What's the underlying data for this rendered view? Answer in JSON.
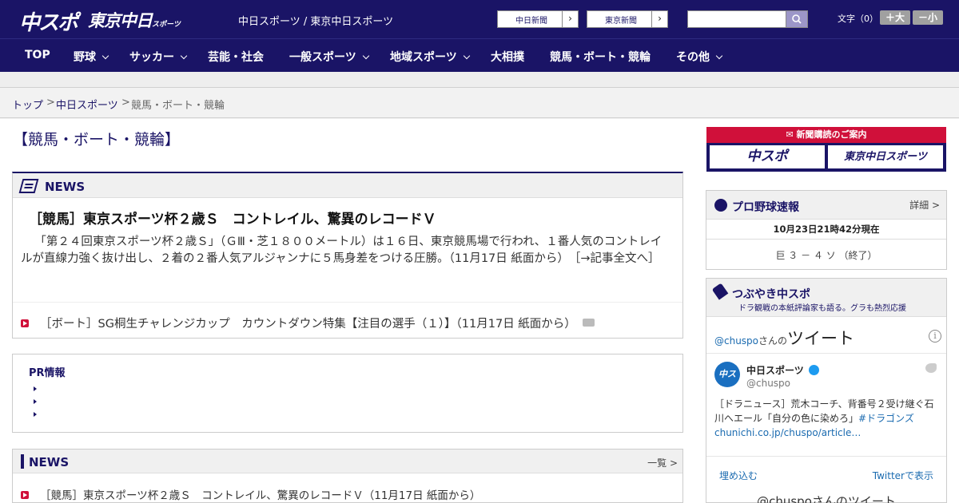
{
  "header": {
    "logo_chuspo": "中スポ",
    "logo_tokyo": "東京中日",
    "logo_tokyo_small": "スポーツ",
    "site_title": "中日スポーツ / 東京中日スポーツ",
    "btn_chunichi": "中日新聞",
    "btn_tokyo": "東京新聞",
    "btn_arrow": "›",
    "search_value": "",
    "fontsize_label": "文字（0）",
    "font_larger": "＋大",
    "font_smaller": "－小"
  },
  "nav": [
    {
      "label": "TOP"
    },
    {
      "label": "野球"
    },
    {
      "label": "サッカー"
    },
    {
      "label": "芸能・社会"
    },
    {
      "label": "一般スポーツ"
    },
    {
      "label": "地域スポーツ"
    },
    {
      "label": "大相撲"
    },
    {
      "label": "競馬・ボート・競輪"
    },
    {
      "label": "その他"
    }
  ],
  "breadcrumb": {
    "top": "トップ",
    "sep": ">",
    "section": "中日スポーツ",
    "current": "競馬・ボート・競輪"
  },
  "page_title": "【競馬・ボート・競輪】",
  "news": {
    "label": "NEWS",
    "headline": "［競馬］東京スポーツ杯２歳Ｓ　コントレイル、驚異のレコードＶ",
    "lead": "「第２４回東京スポーツ杯２歳Ｓ」（ＧⅢ・芝１８００メートル）は１６日、東京競馬場で行われ、１番人気のコントレイルが直線力強く抜け出し、２着の２番人気アルジャンナに５馬身差をつける圧勝。（11月17日 紙面から）　［→記事全文へ］",
    "sub_item": "［ボート］SG桐生チャレンジカップ　カウントダウン特集【注目の選手（１）】（11月17日 紙面から）"
  },
  "pr": {
    "title": "PR情報"
  },
  "news_list": {
    "label": "NEWS",
    "more": "一覧 >",
    "items": [
      "［競馬］東京スポーツ杯２歳Ｓ　コントレイル、驚異のレコードＶ（11月17日 紙面から）"
    ]
  },
  "sidebar": {
    "subscribe_title": "新聞購読のご案内",
    "subscribe_chuspo": "中スポ",
    "subscribe_tokyo": "東京中日スポーツ",
    "baseball_title": "プロ野球速報",
    "baseball_detail": "詳細 >",
    "baseball_time": "10月23日21時42分現在",
    "baseball_score": "巨 ３ － ４ ソ （終了）",
    "tweet_title": "つぶやき中スポ",
    "tweet_sub": "ドラ観戦の本紙評論家も語る。グラも熱烈応援",
    "tweet_handle": "@chuspo",
    "tweet_handle_suffix": "さんの",
    "tweet_word": "ツイート",
    "tweet_info": "i",
    "tweet_avatar": "中スポ",
    "tweet_name": "中日スポーツ",
    "tweet_screen": "@chuspo",
    "tweet_text": "［ドラニュース］荒木コーチ、背番号２受け継ぐ石川へエール「自分の色に染めろ」",
    "tweet_hash": "#ドラゴンズ",
    "tweet_link": "chunichi.co.jp/chuspo/article…",
    "tweet_embed": "埋め込む",
    "tweet_view": "Twitterで表示",
    "tweet_footer": "@chuspoさんのツイート"
  }
}
